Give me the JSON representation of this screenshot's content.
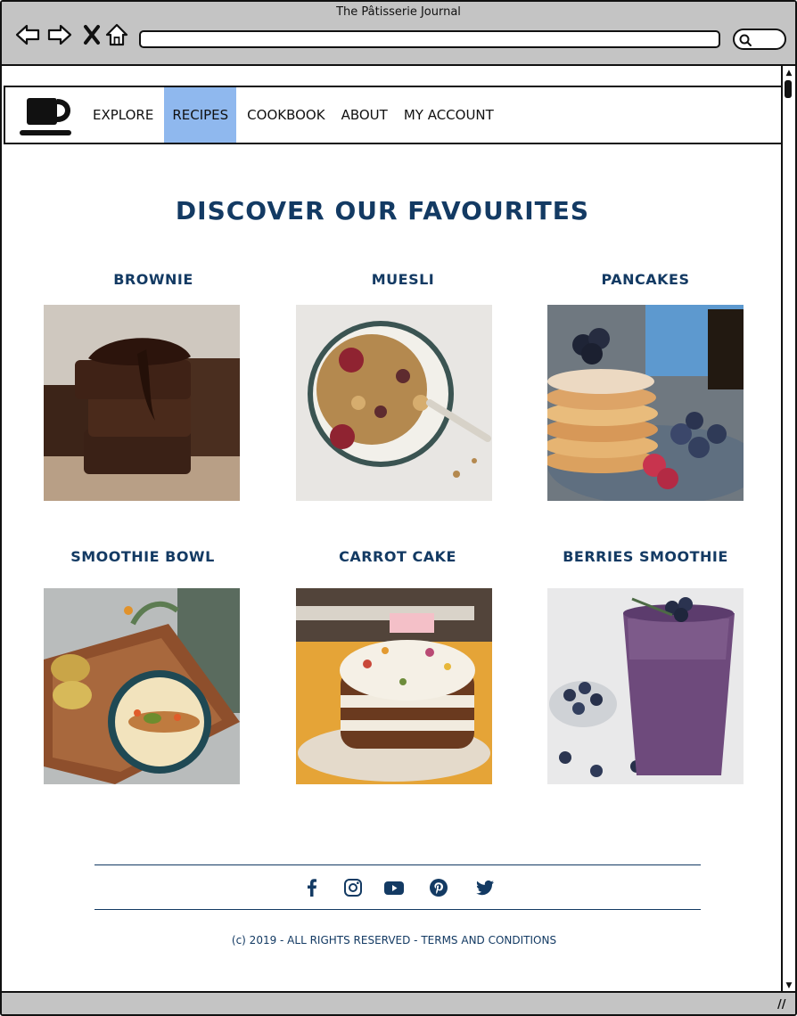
{
  "window": {
    "title": "The Pâtisserie Journal"
  },
  "nav": {
    "items": [
      {
        "label": "EXPLORE",
        "active": false
      },
      {
        "label": "RECIPES",
        "active": true
      },
      {
        "label": "COOKBOOK",
        "active": false
      },
      {
        "label": "ABOUT",
        "active": false
      },
      {
        "label": "MY ACCOUNT",
        "active": false
      }
    ],
    "active_color": "#8fb8ee",
    "logo_icon": "coffee-cup-icon"
  },
  "main": {
    "title": "DISCOVER OUR FAVOURITES",
    "title_color": "#133a63",
    "recipes": [
      {
        "name": "BROWNIE",
        "image": "brownie-photo"
      },
      {
        "name": "MUESLI",
        "image": "muesli-photo"
      },
      {
        "name": "PANCAKES",
        "image": "pancakes-photo"
      },
      {
        "name": "SMOOTHIE BOWL",
        "image": "smoothie-bowl-photo"
      },
      {
        "name": "CARROT CAKE",
        "image": "carrot-cake-photo"
      },
      {
        "name": "BERRIES SMOOTHIE",
        "image": "berries-smoothie-photo"
      }
    ]
  },
  "footer": {
    "social": [
      "facebook-icon",
      "instagram-icon",
      "youtube-icon",
      "pinterest-icon",
      "twitter-icon"
    ],
    "copyright": "(c) 2019 - ALL RIGHTS RESERVED - TERMS AND CONDITIONS"
  }
}
